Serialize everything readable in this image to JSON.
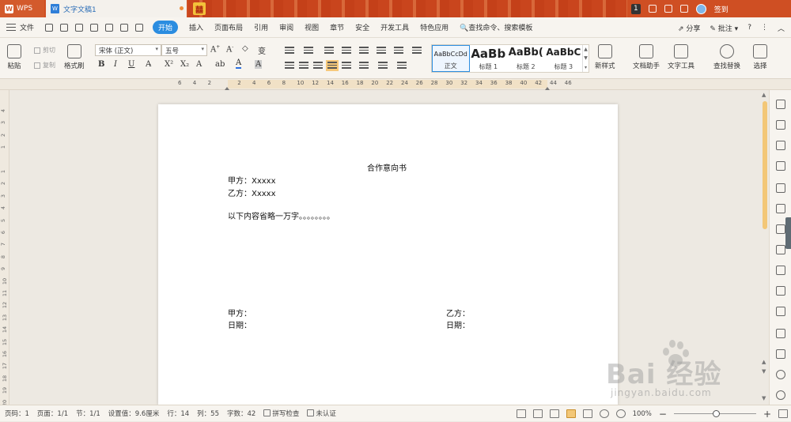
{
  "titlebar": {
    "app_tab": "WPS",
    "doc_tab": "文字文稿1",
    "badge_count": "1",
    "user_label": "签到"
  },
  "menu": {
    "file": "文件",
    "items": [
      "开始",
      "插入",
      "页面布局",
      "引用",
      "审阅",
      "视图",
      "章节",
      "安全",
      "开发工具",
      "特色应用"
    ],
    "search": "查找命令、搜索模板",
    "share": "分享",
    "comment": "批注",
    "help": "?"
  },
  "ribbon": {
    "paste": "粘贴",
    "cut": "剪切",
    "copy": "复制",
    "format_painter": "格式刷",
    "font_name": "宋体 (正文)",
    "font_size": "五号",
    "bold": "B",
    "italic": "I",
    "underline": "U",
    "styles": [
      {
        "preview": "AaBbCcDd",
        "name": "正文"
      },
      {
        "preview": "AaBb",
        "name": "标题 1"
      },
      {
        "preview": "AaBb(",
        "name": "标题 2"
      },
      {
        "preview": "AaBbC",
        "name": "标题 3"
      }
    ],
    "new_style": "新样式",
    "doc_helper": "文档助手",
    "text_tools": "文字工具",
    "find_replace": "查找替换",
    "select": "选择"
  },
  "ruler": {
    "ticks": [
      "6",
      "4",
      "2",
      "",
      "2",
      "4",
      "6",
      "8",
      "10",
      "12",
      "14",
      "16",
      "18",
      "20",
      "22",
      "24",
      "26",
      "28",
      "30",
      "32",
      "34",
      "36",
      "38",
      "40",
      "42",
      "44",
      "46"
    ],
    "vticks": [
      "4",
      "3",
      "2",
      "1",
      "",
      "1",
      "2",
      "3",
      "4",
      "5",
      "6",
      "7",
      "8",
      "9",
      "10",
      "11",
      "12",
      "13",
      "14",
      "15",
      "16",
      "17",
      "18",
      "19",
      "20"
    ]
  },
  "document": {
    "title": "合作意向书",
    "party_a": "甲方：Xxxxx",
    "party_b": "乙方：Xxxxx",
    "body": "以下内容省略一万字。。。。。。。。",
    "sign_a": "甲方：",
    "date_a": "日期：",
    "sign_b": "乙方：",
    "date_b": "日期："
  },
  "status": {
    "page_num": "页码：1",
    "pages": "页面：1/1",
    "section": "节：1/1",
    "setting": "设置值：9.6厘米",
    "row": "行：14",
    "col": "列：55",
    "words": "字数：42",
    "spell": "拼写检查",
    "auth": "未认证",
    "zoom": "100%",
    "zoom_level": 0.52
  },
  "watermark": {
    "brand": "Bai  经验",
    "url": "jingyan.baidu.com"
  },
  "colors": {
    "titlebar": "#cf4f23",
    "accent": "#2b8de0",
    "highlight": "#f3c777"
  }
}
